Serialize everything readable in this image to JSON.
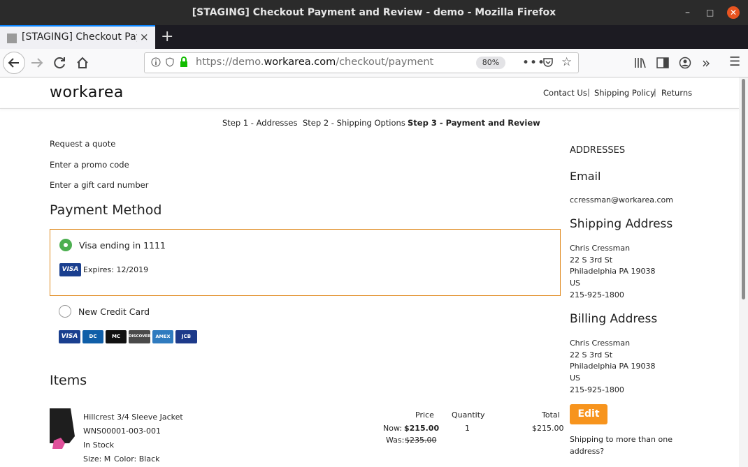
{
  "window": {
    "title": "[STAGING] Checkout Payment and Review - demo - Mozilla Firefox"
  },
  "tab": {
    "title": "[STAGING] Checkout Payment and Review",
    "close": "×",
    "new": "+"
  },
  "url": {
    "scheme": "https://demo.",
    "domain": "workarea.com",
    "path": "/checkout/payment",
    "zoom": "80%"
  },
  "header": {
    "logo": "workarea",
    "links": [
      "Contact Us",
      "Shipping Policy",
      "Returns"
    ]
  },
  "steps": [
    "Step 1 - Addresses",
    "Step 2 - Shipping Options",
    "Step 3 - Payment and Review"
  ],
  "links": [
    "Request a quote",
    "Enter a promo code",
    "Enter a gift card number"
  ],
  "payment": {
    "title": "Payment Method",
    "saved": {
      "label": "Visa ending in 1111",
      "card": "VISA",
      "expires": "Expires: 12/2019"
    },
    "new": {
      "label": "New Credit Card",
      "cards": [
        "VISA",
        "DC",
        "MC",
        "DISCOVER",
        "AMEX",
        "JCB"
      ]
    }
  },
  "items": {
    "title": "Items",
    "headers": {
      "price": "Price",
      "quantity": "Quantity",
      "total": "Total"
    },
    "rows": [
      {
        "name": "Hillcrest 3/4 Sleeve Jacket",
        "sku": "WNS00001-003-001",
        "stock": "In Stock",
        "size": "Size: M",
        "color": "Color: Black",
        "now_label": "Now:",
        "now": "$215.00",
        "was_label": "Was:",
        "was": "$235.00",
        "qty": "1",
        "total": "$215.00"
      }
    ]
  },
  "sidebar": {
    "heading": "ADDRESSES",
    "email_title": "Email",
    "email": "ccressman@workarea.com",
    "shipping_title": "Shipping Address",
    "shipping": [
      "Chris Cressman",
      "22 S 3rd St",
      "Philadelphia PA 19038",
      "US",
      "215-925-1800"
    ],
    "billing_title": "Billing Address",
    "billing": [
      "Chris Cressman",
      "22 S 3rd St",
      "Philadelphia PA 19038",
      "US",
      "215-925-1800"
    ],
    "edit": "Edit",
    "multi": [
      "Shipping to more than one",
      "address?"
    ]
  }
}
